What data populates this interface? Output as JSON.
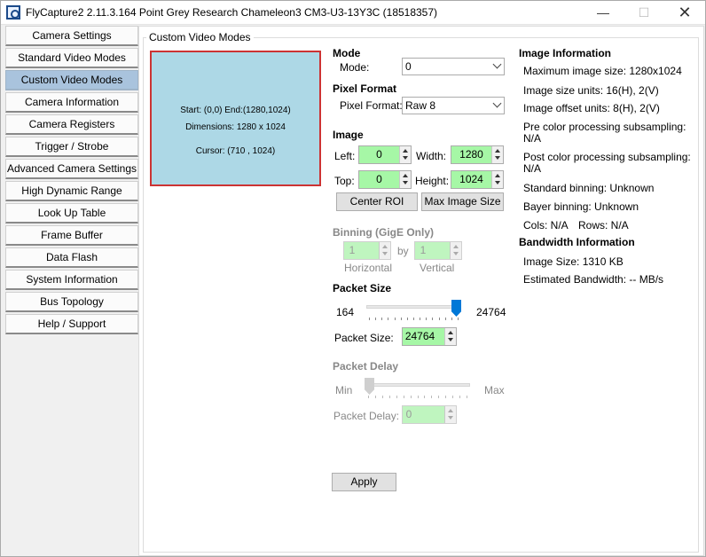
{
  "window": {
    "title": "FlyCapture2 2.11.3.164  Point Grey Research Chameleon3 CM3-U3-13Y3C (18518357)",
    "minimize": "—",
    "maximize": "☐",
    "close": "✕"
  },
  "sidebar": {
    "items": [
      {
        "label": "Camera Settings",
        "active": false
      },
      {
        "label": "Standard Video Modes",
        "active": false
      },
      {
        "label": "Custom Video Modes",
        "active": true
      },
      {
        "label": "Camera Information",
        "active": false
      },
      {
        "label": "Camera Registers",
        "active": false
      },
      {
        "label": "Trigger / Strobe",
        "active": false
      },
      {
        "label": "Advanced Camera Settings",
        "active": false
      },
      {
        "label": "High Dynamic Range",
        "active": false
      },
      {
        "label": "Look Up Table",
        "active": false
      },
      {
        "label": "Frame Buffer",
        "active": false
      },
      {
        "label": "Data Flash",
        "active": false
      },
      {
        "label": "System Information",
        "active": false
      },
      {
        "label": "Bus Topology",
        "active": false
      },
      {
        "label": "Help / Support",
        "active": false
      }
    ]
  },
  "group_title": "Custom Video Modes",
  "preview": {
    "start": "Start:  (0,0) End:(1280,1024)",
    "dimensions": "Dimensions:  1280 x 1024",
    "cursor": "Cursor:  (710 , 1024)"
  },
  "mode": {
    "header": "Mode",
    "label": "Mode:",
    "value": "0"
  },
  "pixel_format": {
    "header": "Pixel Format",
    "label": "Pixel Format:",
    "value": "Raw 8"
  },
  "image": {
    "header": "Image",
    "left_label": "Left:",
    "left_value": "0",
    "width_label": "Width:",
    "width_value": "1280",
    "top_label": "Top:",
    "top_value": "0",
    "height_label": "Height:",
    "height_value": "1024",
    "center_roi": "Center ROI",
    "max_image_size": "Max Image Size"
  },
  "binning": {
    "header": "Binning (GigE Only)",
    "horizontal_value": "1",
    "by": "by",
    "vertical_value": "1",
    "horizontal_label": "Horizontal",
    "vertical_label": "Vertical"
  },
  "packet_size": {
    "header": "Packet Size",
    "min": "164",
    "max": "24764",
    "slider_fraction": 1.0,
    "label": "Packet Size:",
    "value": "24764"
  },
  "packet_delay": {
    "header": "Packet Delay",
    "min": "Min",
    "max": "Max",
    "slider_fraction": 0.0,
    "label": "Packet Delay:",
    "value": "0"
  },
  "apply": "Apply",
  "info": {
    "header": "Image Information",
    "max_size": "Maximum image size: 1280x1024",
    "size_units": "Image size units: 16(H), 2(V)",
    "offset_units": "Image offset units: 8(H), 2(V)",
    "pre_color_1": "Pre color processing subsampling:",
    "pre_color_2": "N/A",
    "post_color_1": "Post color processing subsampling:",
    "post_color_2": "N/A",
    "standard_binning": "Standard binning: Unknown",
    "bayer_binning": "Bayer binning: Unknown",
    "cols": "Cols: N/A",
    "rows": "Rows: N/A"
  },
  "bandwidth": {
    "header": "Bandwidth Information",
    "image_size": "Image Size: 1310 KB",
    "estimated": "Estimated Bandwidth: -- MB/s"
  }
}
